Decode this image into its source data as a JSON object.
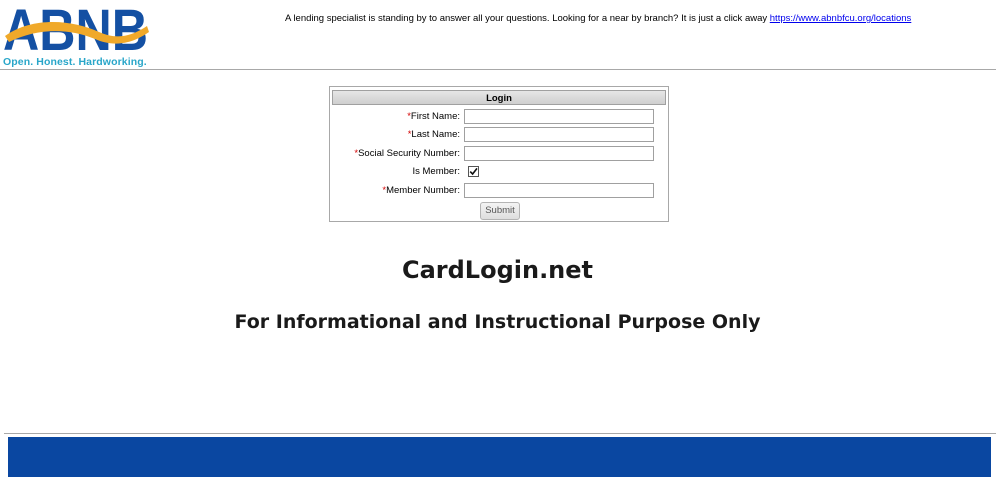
{
  "brand": {
    "logo_text": "ABNB",
    "tagline": "Open. Honest. Hardworking.",
    "colors": {
      "logo_blue": "#1450a3",
      "logo_swoosh": "#f0a92a",
      "tagline": "#29a6c9",
      "footer": "#0a47a1",
      "required": "#d40000"
    }
  },
  "header": {
    "message": "A lending specialist is standing by to answer all your questions. Looking for a near by branch? It is just a click away ",
    "link_text": "https://www.abnbfcu.org/locations"
  },
  "login": {
    "title": "Login",
    "required_marker": "*",
    "fields": {
      "first_name": {
        "label": "First Name:",
        "value": ""
      },
      "last_name": {
        "label": "Last Name:",
        "value": ""
      },
      "ssn": {
        "label": "Social Security Number:",
        "value": ""
      },
      "is_member": {
        "label": "Is Member:",
        "checked": true
      },
      "member_number": {
        "label": "Member Number:",
        "value": ""
      }
    },
    "submit_label": "Submit"
  },
  "main": {
    "title": "CardLogin.net",
    "subtitle": "For Informational and Instructional Purpose Only"
  }
}
